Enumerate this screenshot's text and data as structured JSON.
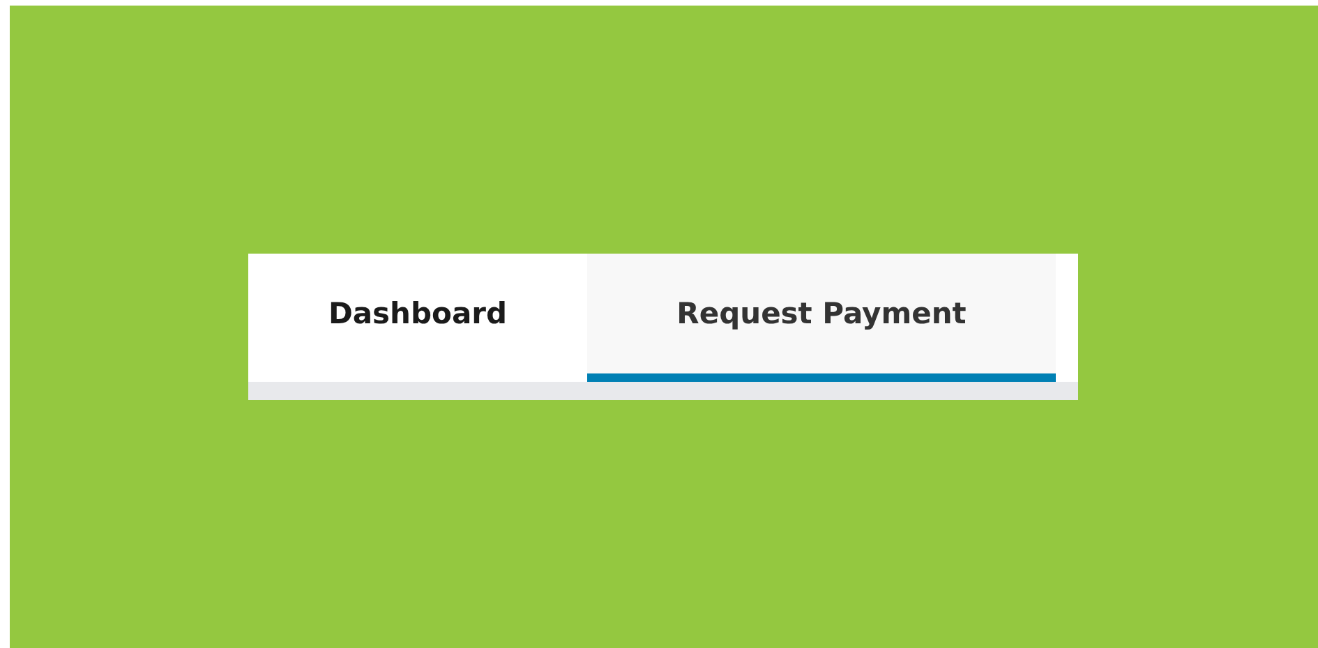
{
  "tabs": [
    {
      "label": "Dashboard",
      "selected": false
    },
    {
      "label": "Request Payment",
      "selected": true
    }
  ]
}
